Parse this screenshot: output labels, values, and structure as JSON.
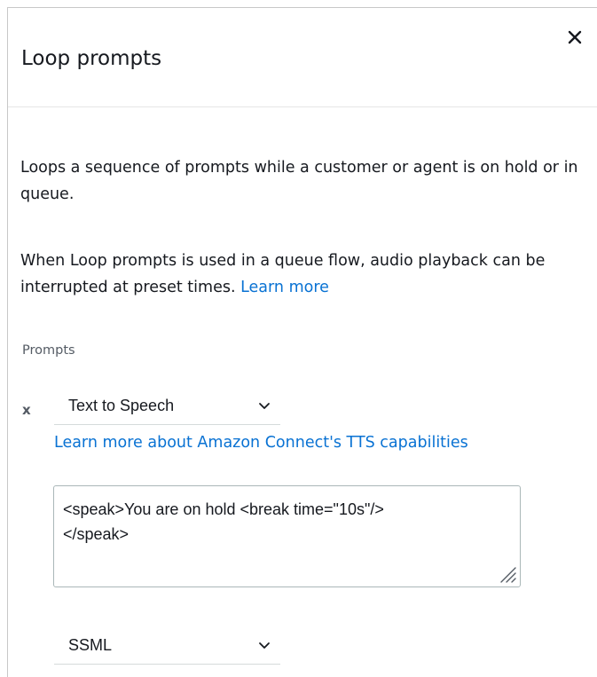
{
  "panel": {
    "title": "Loop prompts",
    "close_icon": "close-icon"
  },
  "description": {
    "para1": "Loops a sequence of prompts while a customer or agent is on hold or in queue.",
    "para2_text": "When Loop prompts is used in a queue flow, audio playback can be interrupted at preset times. ",
    "para2_link": "Learn more"
  },
  "prompts": {
    "section_label": "Prompts",
    "remove_label": "x",
    "type_select": {
      "value": "Text to Speech",
      "icon": "chevron-down-icon"
    },
    "tts_link": "Learn more about Amazon Connect's TTS capabilities",
    "text_value": "<speak>You are on hold <break time=\"10s\"/>\n</speak>",
    "resize_icon": "resize-handle-icon",
    "format_select": {
      "value": "SSML",
      "icon": "chevron-down-icon"
    }
  },
  "colors": {
    "link": "#0972d3",
    "text": "#16191f",
    "muted": "#545b64",
    "border": "#aab7b8"
  }
}
